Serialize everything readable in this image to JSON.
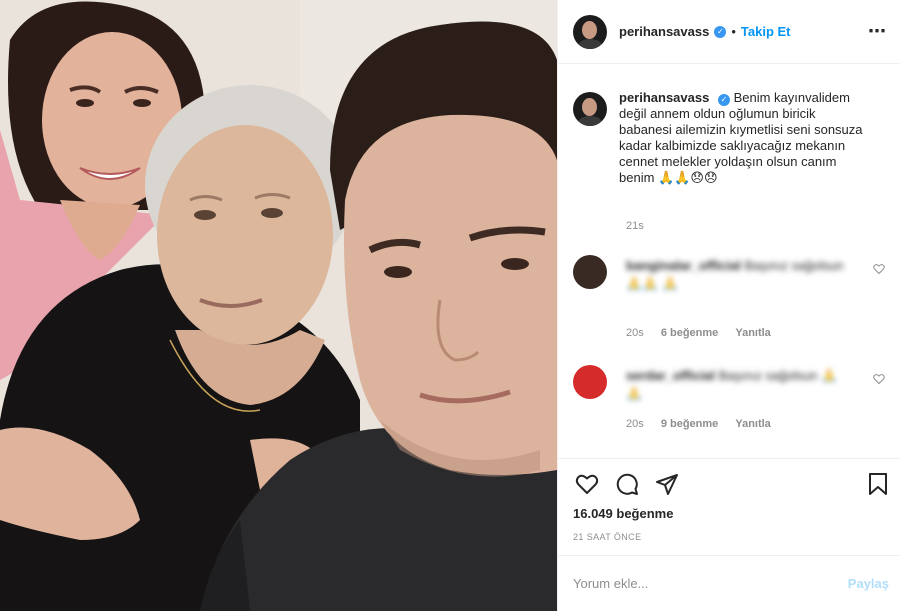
{
  "post": {
    "username": "perihansavass",
    "verified_mark": "✓",
    "dot": "•",
    "follow_label": "Takip Et",
    "more_icon": "⋯"
  },
  "caption": {
    "username": "perihansavass",
    "text": "Benim kayınvalidem değil annem oldun oğlumun biricik babanesi ailemizin kıymetlisi seni sonsuza kadar kalbimizde saklıyacağız mekanın cennet melekler yoldaşın olsun canım benim 🙏🙏😞😞",
    "time": "21s"
  },
  "comments": [
    {
      "blurred_name": "banginalar_official",
      "blurred_text": "Başınız sağolsun 🙏🙏 🙏",
      "avatar_color": "#3a2a24",
      "time": "20s",
      "likes": "6 beğenme",
      "reply": "Yanıtla"
    },
    {
      "blurred_name": "serdar_official",
      "blurred_text": "Başınız sağolsun 🙏🙏",
      "avatar_color": "#d62b2b",
      "time": "20s",
      "likes": "9 beğenme",
      "reply": "Yanıtla"
    }
  ],
  "footer": {
    "likes": "16.049 beğenme",
    "posted_ago": "21 SAAT ÖNCE",
    "comment_placeholder": "Yorum ekle...",
    "post_label": "Paylaş"
  },
  "colors": {
    "accent": "#0095f6",
    "verified": "#3897f0",
    "muted": "#8e8e8e",
    "text": "#262626",
    "divider": "#efefef"
  },
  "icons": [
    "heart-icon",
    "comment-icon",
    "share-icon",
    "bookmark-icon",
    "more-icon",
    "verified-icon"
  ]
}
